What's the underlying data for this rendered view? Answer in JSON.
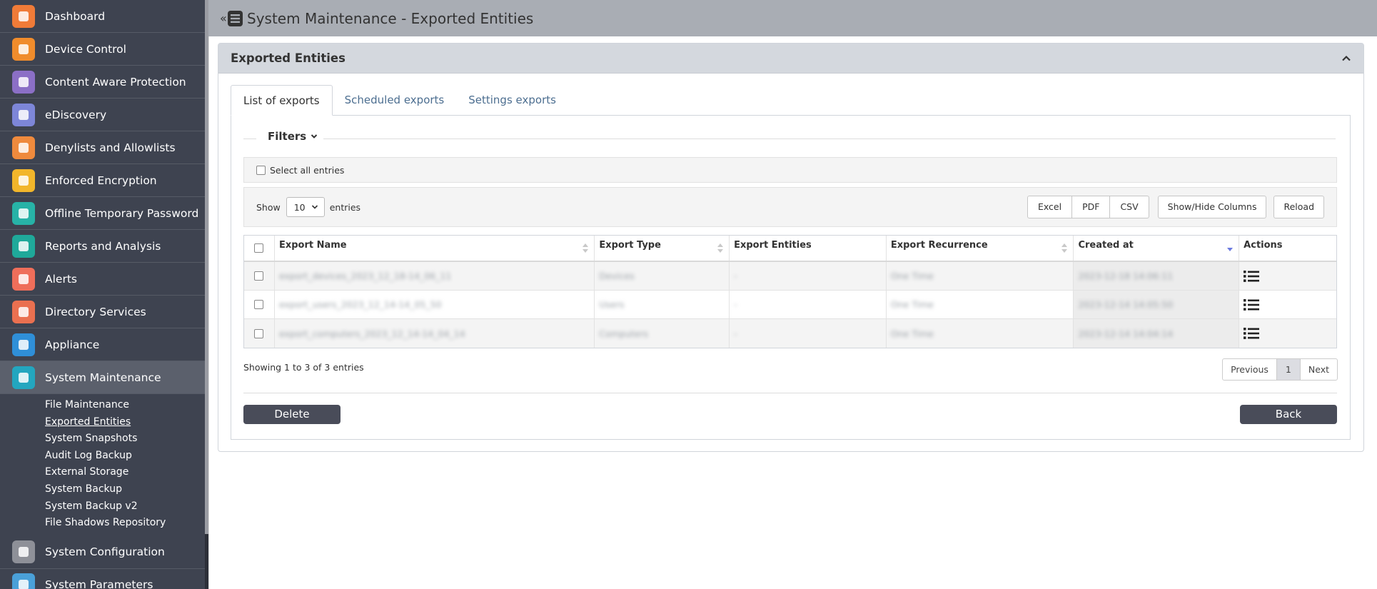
{
  "sidebar": {
    "items": [
      {
        "label": "Dashboard",
        "icon": "dashboard-icon",
        "color": "#f07b38"
      },
      {
        "label": "Device Control",
        "icon": "usb-icon",
        "color": "#f08c2c"
      },
      {
        "label": "Content Aware Protection",
        "icon": "document-search-icon",
        "color": "#8b6fc6"
      },
      {
        "label": "eDiscovery",
        "icon": "telescope-icon",
        "color": "#7d86d8"
      },
      {
        "label": "Denylists and Allowlists",
        "icon": "list-window-icon",
        "color": "#ef8a3d"
      },
      {
        "label": "Enforced Encryption",
        "icon": "disc-icon",
        "color": "#f2b62b"
      },
      {
        "label": "Offline Temporary Password",
        "icon": "key-device-icon",
        "color": "#27b3a7"
      },
      {
        "label": "Reports and Analysis",
        "icon": "chart-icon",
        "color": "#1fa99a"
      },
      {
        "label": "Alerts",
        "icon": "warning-icon",
        "color": "#ef6e5a"
      },
      {
        "label": "Directory Services",
        "icon": "folder-sync-icon",
        "color": "#ea7050"
      },
      {
        "label": "Appliance",
        "icon": "appliance-icon",
        "color": "#2f8fd8"
      },
      {
        "label": "System Maintenance",
        "icon": "tools-icon",
        "color": "#23a6bf"
      }
    ],
    "sub_items": [
      "File Maintenance",
      "Exported Entities",
      "System Snapshots",
      "Audit Log Backup",
      "External Storage",
      "System Backup",
      "System Backup v2",
      "File Shadows Repository"
    ],
    "bottom_items": [
      {
        "label": "System Configuration",
        "icon": "gear-icon",
        "color": "#8e9098"
      },
      {
        "label": "System Parameters",
        "icon": "parameters-icon",
        "color": "#4aa0d8"
      }
    ]
  },
  "header": {
    "title": "System Maintenance - Exported Entities"
  },
  "panel": {
    "title": "Exported Entities",
    "tabs": [
      "List of exports",
      "Scheduled exports",
      "Settings exports"
    ],
    "filters_label": "Filters",
    "select_all_label": "Select all entries",
    "show_label": "Show",
    "show_value": "10",
    "entries_label": "entries",
    "export_buttons": [
      "Excel",
      "PDF",
      "CSV"
    ],
    "show_hide_label": "Show/Hide Columns",
    "reload_label": "Reload",
    "columns": [
      "Export Name",
      "Export Type",
      "Export Entities",
      "Export Recurrence",
      "Created at",
      "Actions"
    ],
    "rows": [
      {
        "name": "export_devices_2023_12_18-14_06_11",
        "type": "Devices",
        "entities": "-",
        "recurrence": "One Time",
        "created": "2023-12-18 14:06:11"
      },
      {
        "name": "export_users_2023_12_14-14_05_50",
        "type": "Users",
        "entities": "-",
        "recurrence": "One Time",
        "created": "2023-12-14 14:05:50"
      },
      {
        "name": "export_computers_2023_12_14-14_04_14",
        "type": "Computers",
        "entities": "-",
        "recurrence": "One Time",
        "created": "2023-12-14 14:04:14"
      }
    ],
    "showing_text": "Showing 1 to 3 of 3 entries",
    "pagination": {
      "previous": "Previous",
      "current": "1",
      "next": "Next"
    },
    "delete_label": "Delete",
    "back_label": "Back"
  }
}
